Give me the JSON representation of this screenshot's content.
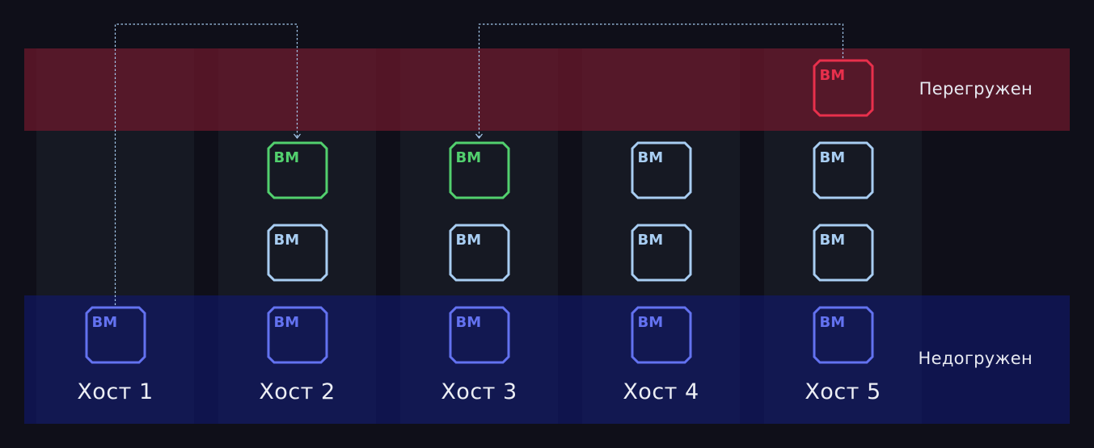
{
  "bands": {
    "overloaded_label": "Перегружен",
    "underloaded_label": "Недогружен"
  },
  "vm_label": "ВМ",
  "hosts": [
    {
      "label": "Хост 1",
      "vms": [
        "blue"
      ]
    },
    {
      "label": "Хост 2",
      "vms": [
        "blue",
        "light",
        "green"
      ]
    },
    {
      "label": "Хост 3",
      "vms": [
        "blue",
        "light",
        "green"
      ]
    },
    {
      "label": "Хост 4",
      "vms": [
        "blue",
        "light",
        "light"
      ]
    },
    {
      "label": "Хост 5",
      "vms": [
        "blue",
        "light",
        "light",
        "red"
      ]
    }
  ],
  "migrations": [
    {
      "from_host": 1,
      "to_host": 2
    },
    {
      "from_host": 5,
      "to_host": 3
    }
  ],
  "colors": {
    "background": "#0f0f19",
    "column": "#161923",
    "overloaded_band": "#70182c",
    "underloaded_band": "#10186e",
    "vm_red": "#e8304c",
    "vm_green": "#52d06e",
    "vm_light": "#a8cdf2",
    "vm_blue": "#6372f0",
    "arrow": "#a8cdf2"
  }
}
